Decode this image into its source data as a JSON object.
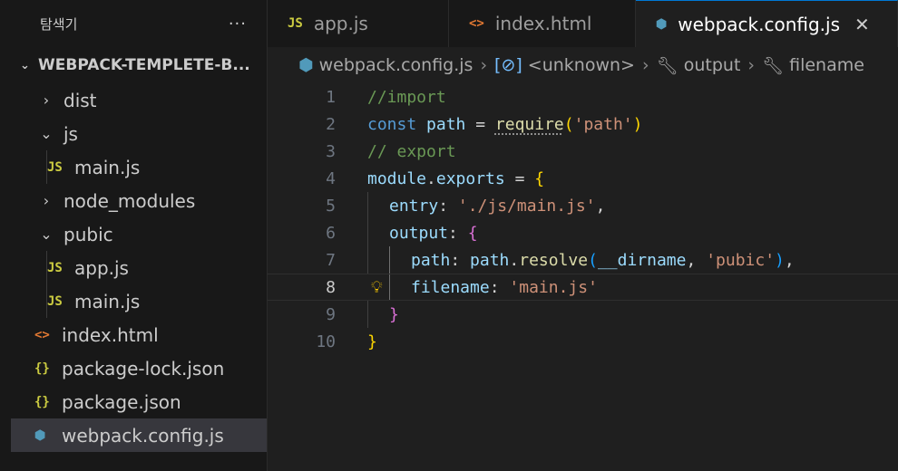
{
  "explorer": {
    "title": "탐색기",
    "more": "···",
    "project": "WEBPACK-TEMPLETE-B...",
    "items": [
      {
        "label": "dist",
        "twisty": "›",
        "icon": ""
      },
      {
        "label": "js",
        "twisty": "⌄",
        "icon": ""
      },
      {
        "label": "main.js",
        "twisty": "",
        "icon": "JS"
      },
      {
        "label": "node_modules",
        "twisty": "›",
        "icon": ""
      },
      {
        "label": "pubic",
        "twisty": "⌄",
        "icon": ""
      },
      {
        "label": "app.js",
        "twisty": "",
        "icon": "JS"
      },
      {
        "label": "main.js",
        "twisty": "",
        "icon": "JS"
      },
      {
        "label": "index.html",
        "twisty": "",
        "icon": "<>"
      },
      {
        "label": "package-lock.json",
        "twisty": "",
        "icon": "{}"
      },
      {
        "label": "package.json",
        "twisty": "",
        "icon": "{}"
      },
      {
        "label": "webpack.config.js",
        "twisty": "",
        "icon": "⬢"
      }
    ]
  },
  "tabs": [
    {
      "label": "app.js",
      "icon": "JS"
    },
    {
      "label": "index.html",
      "icon": "<>"
    },
    {
      "label": "webpack.config.js",
      "icon": "⬢",
      "close": "✕"
    }
  ],
  "breadcrumb": {
    "file": "webpack.config.js",
    "symbol": "<unknown>",
    "prop1": "output",
    "prop2": "filename"
  },
  "code": {
    "line_numbers": [
      "1",
      "2",
      "3",
      "4",
      "5",
      "6",
      "7",
      "8",
      "9",
      "10"
    ],
    "l1_comment": "//import",
    "l2_const": "const",
    "l2_path": "path",
    "l2_eq": " = ",
    "l2_require": "require",
    "l2_open": "(",
    "l2_str": "'path'",
    "l2_close": ")",
    "l3_comment": "// export",
    "l4_module": "module",
    "l4_dot": ".",
    "l4_exports": "exports",
    "l4_eq": " = ",
    "l4_brace": "{",
    "l5_key": "entry",
    "l5_colon": ": ",
    "l5_str": "'./js/main.js'",
    "l5_comma": ",",
    "l6_key": "output",
    "l6_colon": ": ",
    "l6_brace": "{",
    "l7_key": "path",
    "l7_colon": ": ",
    "l7_path": "path",
    "l7_dot": ".",
    "l7_resolve": "resolve",
    "l7_open": "(",
    "l7_dirname": "__dirname",
    "l7_sep": ", ",
    "l7_str": "'pubic'",
    "l7_close": ")",
    "l7_comma": ",",
    "l8_key": "filename",
    "l8_colon": ": ",
    "l8_str": "'main.js'",
    "l9_brace": "}",
    "l10_brace": "}"
  }
}
